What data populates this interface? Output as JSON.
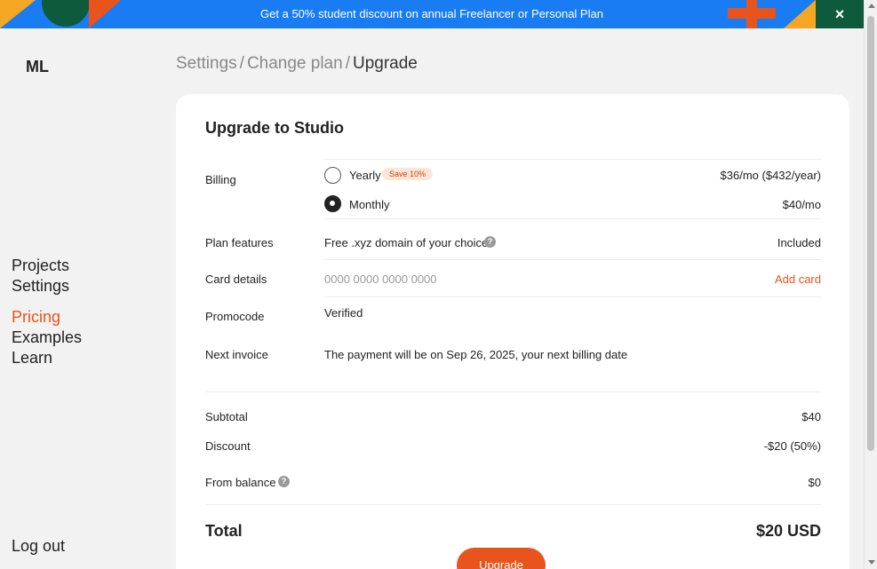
{
  "banner": {
    "text": "Get a 50% student discount on annual Freelancer or Personal Plan",
    "close_label": "×",
    "colors": {
      "background": "#1a7cf2",
      "accent_orange": "#e8541b",
      "accent_yellow": "#f5a623",
      "accent_green": "#0e5a3c"
    }
  },
  "sidebar": {
    "logo": "ML",
    "items": [
      {
        "label": "Projects",
        "active": false
      },
      {
        "label": "Settings",
        "active": false
      },
      {
        "label": "Pricing",
        "active": true
      },
      {
        "label": "Examples",
        "active": false
      },
      {
        "label": "Learn",
        "active": false
      }
    ],
    "logout": "Log out"
  },
  "breadcrumb": {
    "items": [
      "Settings",
      "Change plan",
      "Upgrade"
    ],
    "separator": "/"
  },
  "checkout": {
    "title": "Upgrade to Studio",
    "billing": {
      "label": "Billing",
      "options": [
        {
          "name": "Yearly",
          "badge": "Save 10%",
          "price": "$36/mo ($432/year)",
          "selected": false
        },
        {
          "name": "Monthly",
          "price": "$40/mo",
          "selected": true
        }
      ]
    },
    "plan_features": {
      "label": "Plan features",
      "value": "Free .xyz domain of your choice",
      "help": "?",
      "status": "Included"
    },
    "card_details": {
      "label": "Card details",
      "placeholder": "0000 0000 0000 0000",
      "action": "Add card"
    },
    "promocode": {
      "label": "Promocode",
      "value": "Verified"
    },
    "next_invoice": {
      "label": "Next invoice",
      "value": "The payment will be on Sep 26, 2025, your next billing date"
    },
    "subtotal": {
      "label": "Subtotal",
      "value": "$40"
    },
    "discount": {
      "label": "Discount",
      "value": "-$20 (50%)"
    },
    "from_balance": {
      "label": "From balance",
      "help": "?",
      "value": "$0"
    },
    "total": {
      "label": "Total",
      "value": "$20 USD"
    },
    "upgrade_button": "Upgrade"
  }
}
